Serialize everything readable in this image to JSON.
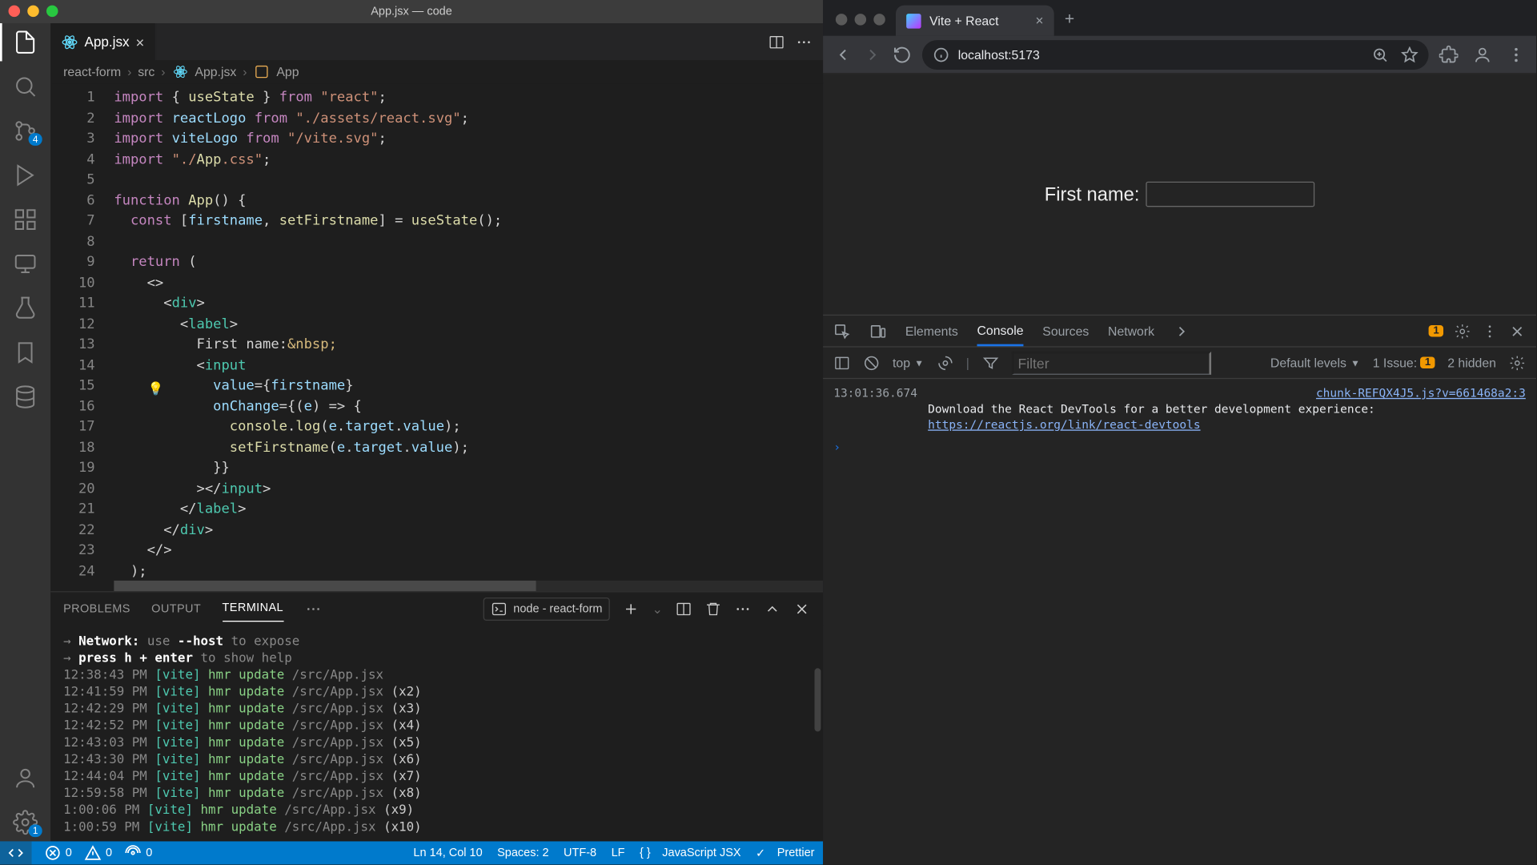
{
  "vscode": {
    "window_title": "App.jsx — code",
    "activity_badge_scm": "4",
    "activity_badge_settings": "1",
    "tab": {
      "label": "App.jsx"
    },
    "breadcrumb": {
      "a": "react-form",
      "b": "src",
      "c": "App.jsx",
      "d": "App"
    },
    "code_lines": [
      "import { useState } from \"react\";",
      "import reactLogo from \"./assets/react.svg\";",
      "import viteLogo from \"/vite.svg\";",
      "import \"./App.css\";",
      "",
      "function App() {",
      "  const [firstname, setFirstname] = useState();",
      "",
      "  return (",
      "    <>",
      "      <div>",
      "        <label>",
      "          First name:&nbsp;",
      "          <input",
      "            value={firstname}",
      "            onChange={(e) => {",
      "              console.log(e.target.value);",
      "              setFirstname(e.target.value);",
      "            }}",
      "          ></input>",
      "        </label>",
      "      </div>",
      "    </>",
      "  );"
    ],
    "line_start": 1,
    "panel": {
      "tabs": {
        "problems": "PROBLEMS",
        "output": "OUTPUT",
        "terminal": "TERMINAL"
      },
      "launch": "node - react-form",
      "terminal_lines": [
        {
          "pre": "  →  ",
          "a": "Network:",
          "b": " use ",
          "c": "--host",
          "d": " to expose"
        },
        {
          "pre": "  →  ",
          "a": "press ",
          "c": "h + enter",
          "d": " to show help"
        }
      ],
      "hmr": [
        {
          "t": "12:38:43 PM",
          "f": "/src/App.jsx",
          "x": ""
        },
        {
          "t": "12:41:59 PM",
          "f": "/src/App.jsx",
          "x": "(x2)"
        },
        {
          "t": "12:42:29 PM",
          "f": "/src/App.jsx",
          "x": "(x3)"
        },
        {
          "t": "12:42:52 PM",
          "f": "/src/App.jsx",
          "x": "(x4)"
        },
        {
          "t": "12:43:03 PM",
          "f": "/src/App.jsx",
          "x": "(x5)"
        },
        {
          "t": "12:43:30 PM",
          "f": "/src/App.jsx",
          "x": "(x6)"
        },
        {
          "t": "12:44:04 PM",
          "f": "/src/App.jsx",
          "x": "(x7)"
        },
        {
          "t": "12:59:58 PM",
          "f": "/src/App.jsx",
          "x": "(x8)"
        },
        {
          "t": "1:00:06 PM",
          "f": "/src/App.jsx",
          "x": "(x9)"
        },
        {
          "t": "1:00:59 PM",
          "f": "/src/App.jsx",
          "x": "(x10)"
        }
      ]
    },
    "status": {
      "errors": "0",
      "warnings": "0",
      "ports": "0",
      "cursor": "Ln 14, Col 10",
      "spaces": "Spaces: 2",
      "encoding": "UTF-8",
      "eol": "LF",
      "lang": "JavaScript JSX",
      "prettier": "Prettier"
    }
  },
  "browser": {
    "tab_title": "Vite + React",
    "url": "localhost:5173",
    "page": {
      "label": "First name:"
    },
    "devtools": {
      "tabs": {
        "elements": "Elements",
        "console": "Console",
        "sources": "Sources",
        "network": "Network"
      },
      "issues_count": "1",
      "issues_label": "1 Issue:",
      "hidden": "2 hidden",
      "filter_placeholder": "Filter",
      "context": "top",
      "levels": "Default levels",
      "time": "13:01:36.674",
      "source_link": "chunk-REFQX4J5.js?v=661468a2:3",
      "msg": "Download the React DevTools for a better development experience:",
      "msg_link": "https://reactjs.org/link/react-devtools"
    }
  }
}
